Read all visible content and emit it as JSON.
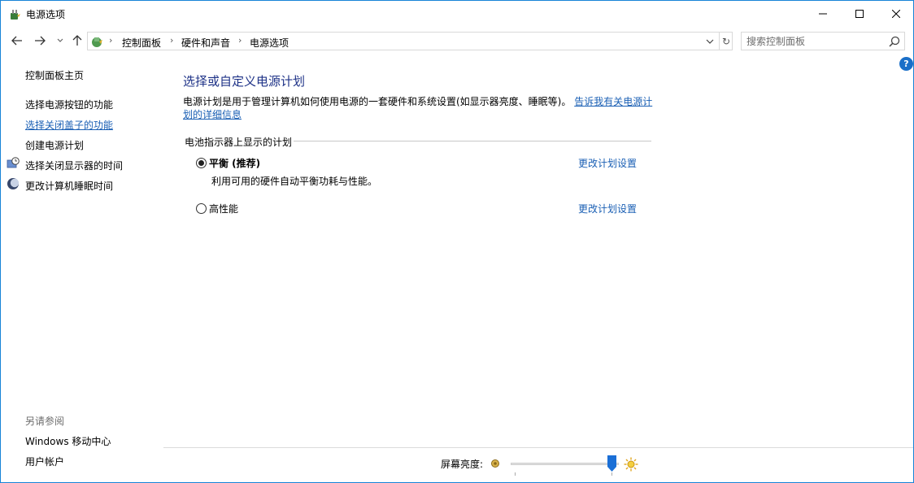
{
  "window": {
    "title": "电源选项",
    "minimize_symbol": "—",
    "maximize_symbol": "☐",
    "close_symbol": "✕"
  },
  "address_bar": {
    "breadcrumbs": [
      "控制面板",
      "硬件和声音",
      "电源选项"
    ],
    "separator": "›",
    "dropdown_symbol": "v",
    "refresh_symbol": "↻"
  },
  "search": {
    "placeholder": "搜索控制面板"
  },
  "help_label": "?",
  "sidebar": {
    "home": "控制面板主页",
    "items": [
      "选择电源按钮的功能",
      "选择关闭盖子的功能",
      "创建电源计划",
      "选择关闭显示器的时间",
      "更改计算机睡眠时间"
    ],
    "active_index": 1,
    "see_also_title": "另请参阅",
    "see_also": [
      "Windows 移动中心",
      "用户帐户"
    ]
  },
  "main": {
    "heading": "选择或自定义电源计划",
    "description": "电源计划是用于管理计算机如何使用电源的一套硬件和系统设置(如显示器亮度、睡眠等)。",
    "description_link": "告诉我有关电源计划的详细信息",
    "group_label": "电池指示器上显示的计划",
    "plans": [
      {
        "name": "平衡 (推荐)",
        "description": "利用可用的硬件自动平衡功耗与性能。",
        "selected": true,
        "link": "更改计划设置"
      },
      {
        "name": "高性能",
        "description": "",
        "selected": false,
        "link": "更改计划设置"
      }
    ]
  },
  "brightness": {
    "label": "屏幕亮度:",
    "value_percent": 100
  },
  "colors": {
    "link": "#1a5fb4",
    "heading": "#1e3287",
    "accent": "#1a6fc8"
  }
}
